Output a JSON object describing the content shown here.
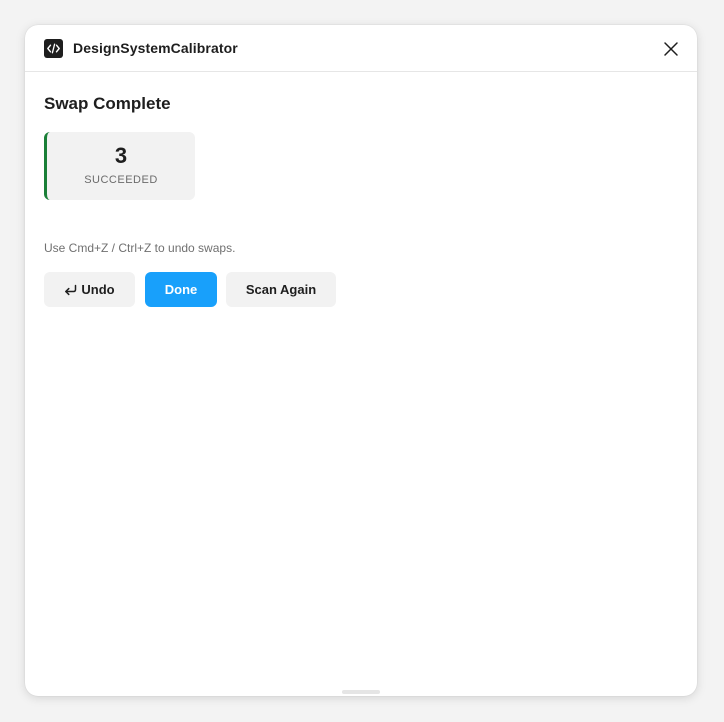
{
  "window": {
    "title": "DesignSystemCalibrator",
    "icon": "code-icon",
    "close_icon": "close-icon"
  },
  "result": {
    "heading": "Swap Complete",
    "stat": {
      "value": "3",
      "label": "SUCCEEDED",
      "accent_color": "#1a7f37"
    },
    "hint": "Use Cmd+Z / Ctrl+Z to undo swaps."
  },
  "actions": {
    "undo": {
      "label": "Undo",
      "icon": "undo-arrow-icon"
    },
    "done": {
      "label": "Done",
      "color": "#18a0fb"
    },
    "scan_again": {
      "label": "Scan Again"
    }
  }
}
